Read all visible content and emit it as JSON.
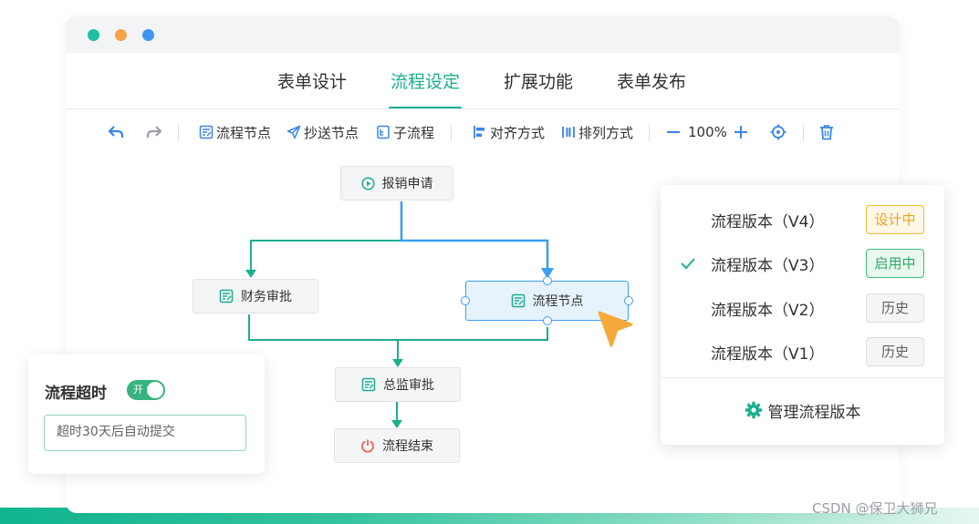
{
  "window": {
    "dots": [
      "#1ec1a0",
      "#f7a14a",
      "#3d96f0"
    ]
  },
  "tabs": [
    {
      "label": "表单设计"
    },
    {
      "label": "流程设定",
      "active": true
    },
    {
      "label": "扩展功能"
    },
    {
      "label": "表单发布"
    }
  ],
  "toolbar": {
    "undo_icon": "undo-icon",
    "redo_icon": "redo-icon",
    "flow_node": "流程节点",
    "cc_node": "抄送节点",
    "subflow": "子流程",
    "align": "对齐方式",
    "arrange": "排列方式",
    "zoom": "100%",
    "locate_icon": "locate-icon",
    "delete_icon": "trash-icon"
  },
  "flow": {
    "start": "报销申请",
    "finance": "财务审批",
    "process": "流程节点",
    "director": "总监审批",
    "end": "流程结束"
  },
  "timeout_panel": {
    "title": "流程超时",
    "toggle_label": "开",
    "toggle_on": true,
    "input_value": "超时30天后自动提交"
  },
  "versions_panel": {
    "versions": [
      {
        "name": "流程版本（V4）",
        "status": "设计中",
        "checked": false
      },
      {
        "name": "流程版本（V3）",
        "status": "启用中",
        "checked": true
      },
      {
        "name": "流程版本（V2）",
        "status": "历史",
        "checked": false
      },
      {
        "name": "流程版本（V1）",
        "status": "历史",
        "checked": false
      }
    ],
    "manage_label": "管理流程版本"
  },
  "colors": {
    "accent": "#1cae8f",
    "selection": "#3a9ef4",
    "warning": "#f0a020",
    "success": "#2ea76a"
  },
  "watermark": "CSDN @保卫大狮兄"
}
